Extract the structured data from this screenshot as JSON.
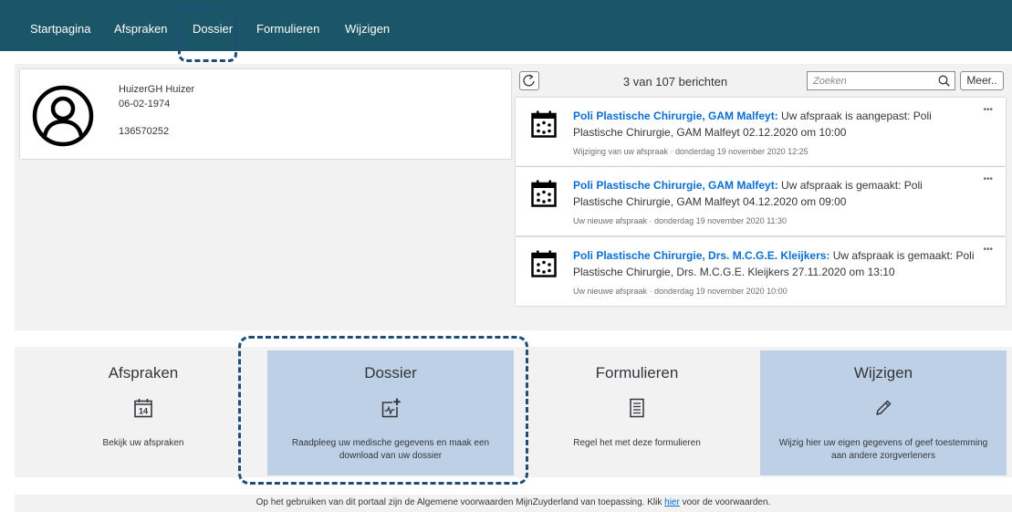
{
  "nav": {
    "items": [
      "Startpagina",
      "Afspraken",
      "Dossier",
      "Formulieren",
      "Wijzigen"
    ]
  },
  "patient": {
    "name": "HuizerGH Huizer",
    "dob": "06-02-1974",
    "id": "136570252"
  },
  "messages": {
    "count_text": "3 van 107 berichten",
    "search_placeholder": "Zoeken",
    "more_label": "Meer..",
    "items": [
      {
        "sender": "Poli Plastische Chirurgie, GAM Malfeyt:",
        "body": " Uw afspraak is aangepast: Poli Plastische Chirurgie, GAM Malfeyt 02.12.2020 om 10:00",
        "meta": "Wijziging van uw afspraak  ·  donderdag 19 november 2020 12:25",
        "actions": "•••"
      },
      {
        "sender": "Poli Plastische Chirurgie, GAM Malfeyt:",
        "body": " Uw afspraak is gemaakt: Poli Plastische Chirurgie, GAM Malfeyt 04.12.2020 om 09:00",
        "meta": "Uw nieuwe afspraak  ·  donderdag 19 november 2020 11:30",
        "actions": "•••"
      },
      {
        "sender": "Poli Plastische Chirurgie, Drs. M.C.G.E. Kleijkers:",
        "body": " Uw afspraak is gemaakt: Poli Plastische Chirurgie, Drs. M.C.G.E. Kleijkers 27.11.2020 om 13:10",
        "meta": "Uw nieuwe afspraak  ·  donderdag 19 november 2020 10:00",
        "actions": "•••"
      }
    ]
  },
  "tiles": [
    {
      "title": "Afspraken",
      "icon": "calendar-14-icon",
      "icon_text": "14",
      "desc": "Bekijk uw afspraken"
    },
    {
      "title": "Dossier",
      "icon": "medical-record-add-icon",
      "desc": "Raadpleeg uw medische gegevens en maak een download van uw dossier"
    },
    {
      "title": "Formulieren",
      "icon": "form-icon",
      "desc": "Regel het met deze formulieren"
    },
    {
      "title": "Wijzigen",
      "icon": "pencil-icon",
      "desc": "Wijzig hier uw eigen gegevens of geef toestemming aan andere zorgverleners"
    }
  ],
  "footer": {
    "before": "Op het gebruiken van dit portaal zijn de Algemene voorwaarden MijnZuyderland van toepassing. Klik ",
    "link": "hier",
    "after": " voor de voorwaarden."
  },
  "colors": {
    "nav_bg": "#1a5668",
    "highlight_tile": "#bed0e5",
    "sender_link": "#0a6ed1",
    "annotation_dash": "#1f4d7a"
  }
}
